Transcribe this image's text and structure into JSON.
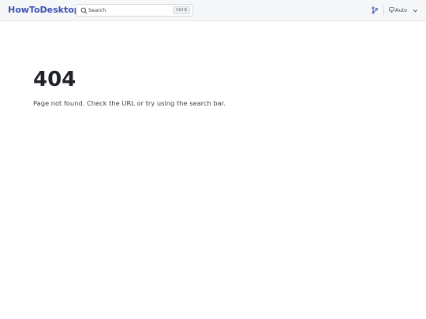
{
  "header": {
    "brand": "HowToDesktop",
    "search": {
      "label": "Search",
      "shortcut": "Ctrl K"
    },
    "theme": {
      "label": "Auto"
    }
  },
  "main": {
    "heading": "404",
    "message": "Page not found. Check the URL or try using the search bar."
  },
  "colors": {
    "brand": "#3b52b4",
    "accent": "#3b52b4",
    "heading": "#1f2328",
    "header_bg": "#f6f7f8"
  },
  "icons": {
    "search": "search-icon",
    "branch": "git-branch-icon",
    "theme": "monitor-icon",
    "dropdown": "chevron-down-icon"
  }
}
